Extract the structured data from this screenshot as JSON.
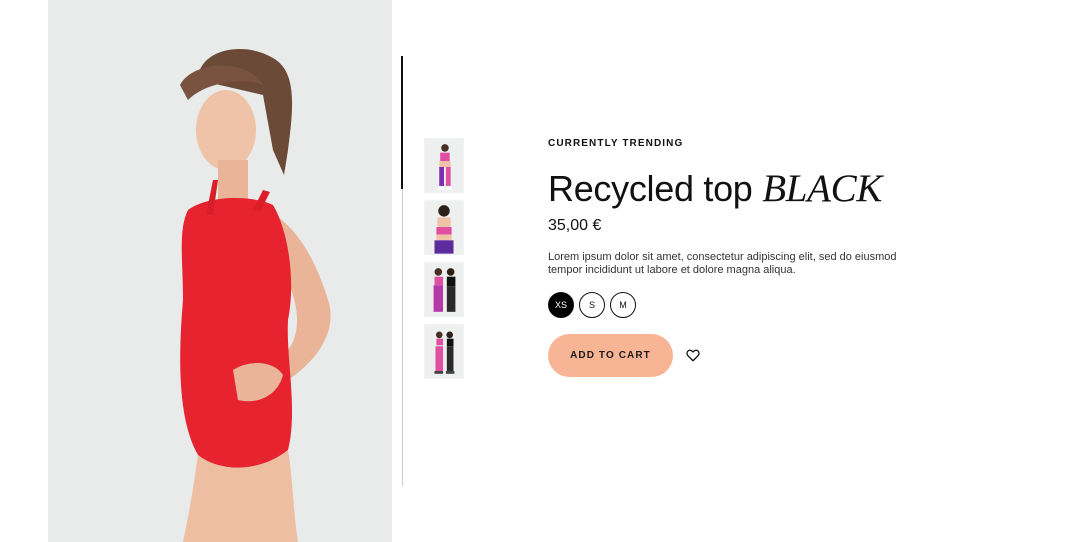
{
  "product": {
    "eyebrow": "CURRENTLY TRENDING",
    "title_main": "Recycled top",
    "title_italic": "BLACK",
    "price": "35,00 €",
    "description": "Lorem ipsum dolor sit amet, consectetur adipiscing elit, sed do eiusmod tempor incididunt ut labore et dolore magna aliqua."
  },
  "sizes": [
    {
      "label": "XS",
      "selected": true
    },
    {
      "label": "S",
      "selected": false
    },
    {
      "label": "M",
      "selected": false
    }
  ],
  "actions": {
    "add_to_cart": "ADD TO CART",
    "wishlist_icon": "heart-icon"
  },
  "thumbnails": [
    {
      "icon": "thumbnail-model-full-body"
    },
    {
      "icon": "thumbnail-model-upper-body"
    },
    {
      "icon": "thumbnail-two-models"
    },
    {
      "icon": "thumbnail-two-models-full"
    }
  ],
  "colors": {
    "accent_button": "#f7b596",
    "selected_size": "#000000",
    "rail_active": "#111111"
  }
}
